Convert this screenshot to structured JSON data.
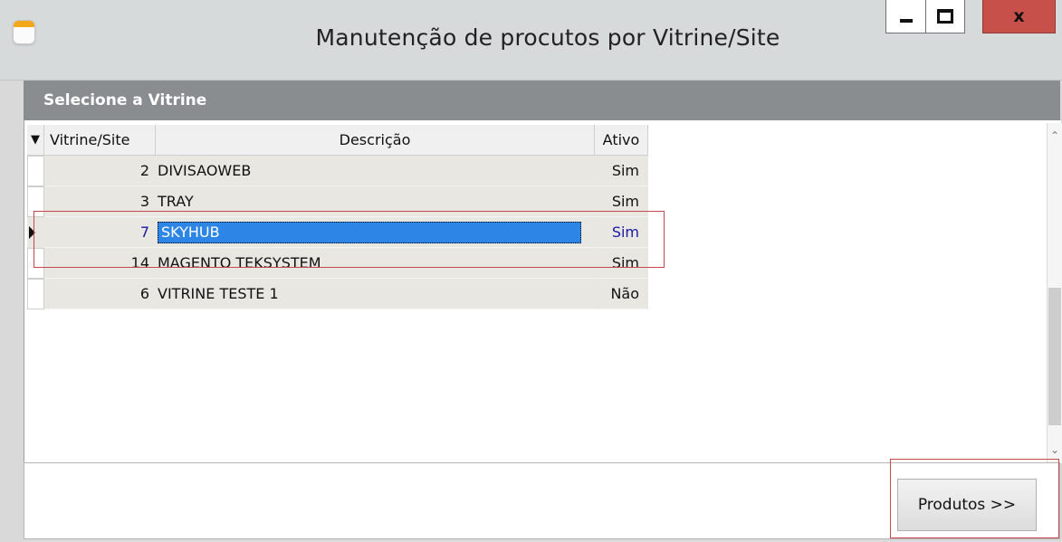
{
  "window": {
    "title": "Manutenção de procutos por Vitrine/Site",
    "close_label": "x"
  },
  "section": {
    "title": "Selecione a Vitrine"
  },
  "grid": {
    "sort_indicator": "▼",
    "columns": [
      "Vitrine/Site",
      "Descrição",
      "Ativo"
    ],
    "rows": [
      {
        "id": "2",
        "descricao": "DIVISAOWEB",
        "ativo": "Sim",
        "selected": false
      },
      {
        "id": "3",
        "descricao": "TRAY",
        "ativo": "Sim",
        "selected": false
      },
      {
        "id": "7",
        "descricao": "SKYHUB",
        "ativo": "Sim",
        "selected": true
      },
      {
        "id": "14",
        "descricao": "MAGENTO TEKSYSTEM",
        "ativo": "Sim",
        "selected": false
      },
      {
        "id": "6",
        "descricao": "VITRINE TESTE 1",
        "ativo": "Não",
        "selected": false
      }
    ]
  },
  "footer": {
    "produtos_label": "Produtos >>"
  },
  "colors": {
    "selection_bg": "#2d86e6",
    "selected_text": "#1a1aa0",
    "header_band": "#8a8d90",
    "highlight_box": "#c8484f"
  }
}
